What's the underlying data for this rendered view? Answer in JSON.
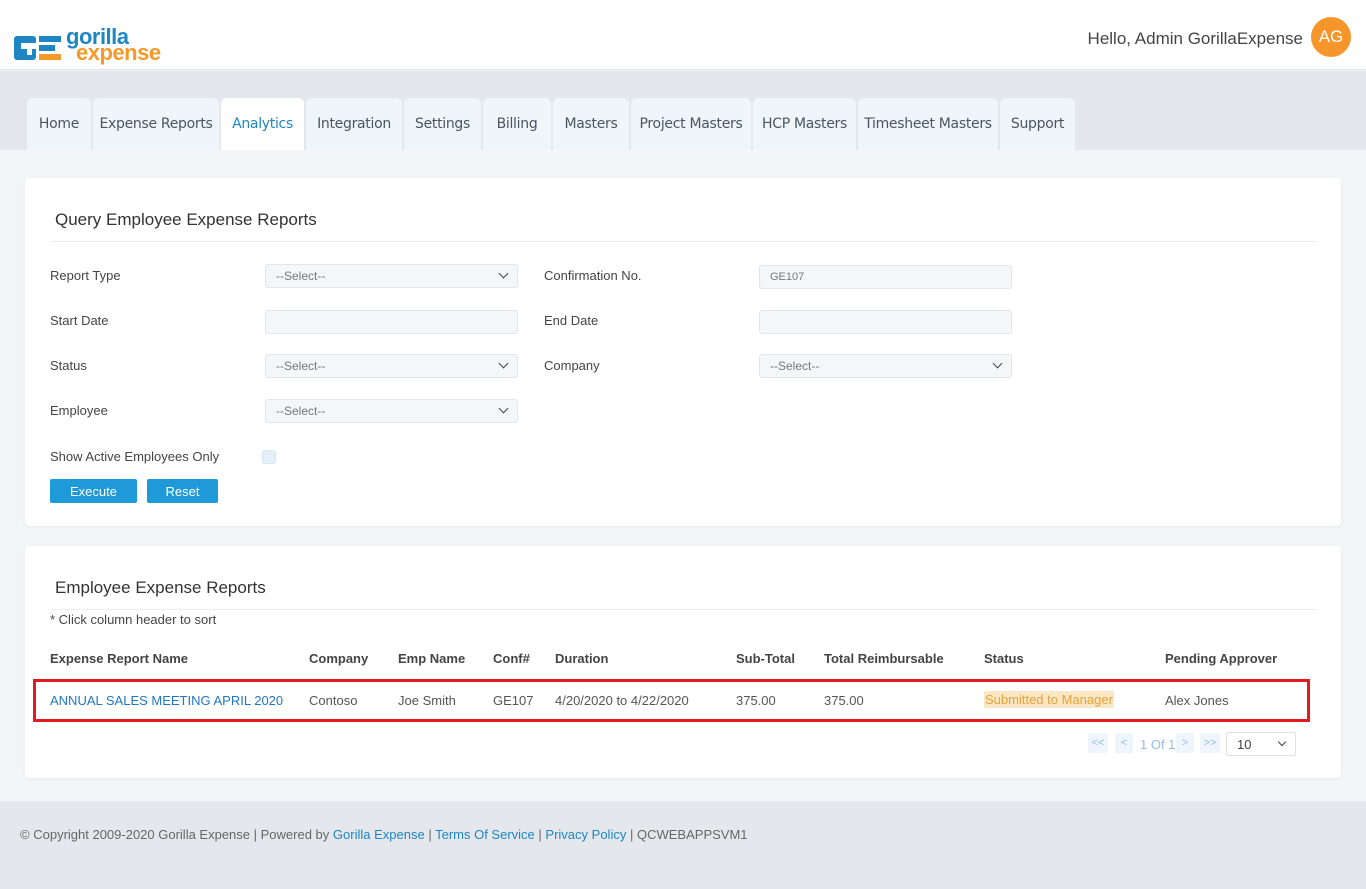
{
  "header": {
    "logo": {
      "line1": "gorilla",
      "line2": "expense"
    },
    "greeting": "Hello, Admin GorillaExpense",
    "avatar_initials": "AG"
  },
  "nav": {
    "tabs": [
      {
        "label": "Home",
        "active": false
      },
      {
        "label": "Expense Reports",
        "active": false
      },
      {
        "label": "Analytics",
        "active": true
      },
      {
        "label": "Integration",
        "active": false
      },
      {
        "label": "Settings",
        "active": false
      },
      {
        "label": "Billing",
        "active": false
      },
      {
        "label": "Masters",
        "active": false
      },
      {
        "label": "Project Masters",
        "active": false
      },
      {
        "label": "HCP Masters",
        "active": false
      },
      {
        "label": "Timesheet Masters",
        "active": false
      },
      {
        "label": "Support",
        "active": false
      }
    ]
  },
  "query": {
    "title": "Query Employee Expense Reports",
    "report_type_label": "Report Type",
    "report_type_value": "--Select--",
    "confirmation_label": "Confirmation No.",
    "confirmation_value": "GE107",
    "start_date_label": "Start Date",
    "start_date_value": "",
    "end_date_label": "End Date",
    "end_date_value": "",
    "status_label": "Status",
    "status_value": "--Select--",
    "company_label": "Company",
    "company_value": "--Select--",
    "employee_label": "Employee",
    "employee_value": "--Select--",
    "active_only_label": "Show Active Employees Only",
    "active_only_checked": false,
    "execute_label": "Execute",
    "reset_label": "Reset"
  },
  "results": {
    "title": "Employee Expense Reports",
    "note": "* Click column header to sort",
    "columns": [
      "Expense Report Name",
      "Company",
      "Emp Name",
      "Conf#",
      "Duration",
      "Sub-Total",
      "Total Reimbursable",
      "Status",
      "Pending Approver"
    ],
    "rows": [
      {
        "name": "ANNUAL SALES MEETING APRIL 2020",
        "company": "Contoso",
        "emp_name": "Joe Smith",
        "conf": "GE107",
        "duration": "4/20/2020 to 4/22/2020",
        "sub_total": "375.00",
        "total_reimbursable": "375.00",
        "status": "Submitted to Manager",
        "pending_approver": "Alex Jones"
      }
    ],
    "pagination": {
      "first": "<<",
      "prev": "<",
      "page_text": "1 Of 1",
      "next": ">",
      "last": ">>",
      "page_size": "10"
    }
  },
  "footer": {
    "copyright": "Copyright 2009-2020 Gorilla Expense | Powered by",
    "powered_link": "Gorilla Expense",
    "sep1": "|",
    "tos_link": "Terms Of Service",
    "sep2": "|",
    "privacy_link": "Privacy Policy",
    "sep3": "|",
    "server": "QCWEBAPPSVM1"
  },
  "colors": {
    "brand_blue": "#1f86c4",
    "brand_orange": "#f39a2b",
    "button_blue": "#1f9ad8",
    "highlight_red": "#e21b22",
    "status_bg": "#fbe7c3"
  }
}
